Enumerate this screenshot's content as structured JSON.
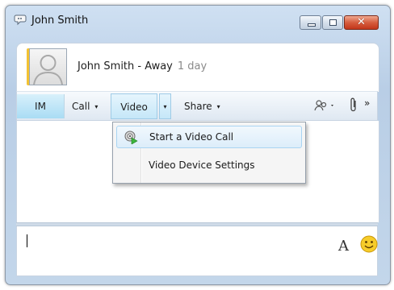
{
  "window": {
    "title": "John Smith",
    "buttons": {
      "minimize": "minimize",
      "maximize": "maximize",
      "close": "✕"
    }
  },
  "contact": {
    "name_status": "John Smith - Away",
    "duration": "1 day"
  },
  "toolbar": {
    "im": "IM",
    "call": "Call",
    "video": "Video",
    "share": "Share",
    "caret": "▾",
    "more": "»"
  },
  "video_menu": {
    "items": [
      {
        "label": "Start a Video Call",
        "highlighted": true,
        "icon": "video-call-icon"
      },
      {
        "label": "Video Device Settings",
        "highlighted": false
      }
    ]
  },
  "compose": {
    "font_label": "A"
  },
  "colors": {
    "presence_away": "#f3c233",
    "im_tab": "#a9dcf4",
    "menu_highlight": "#dcedfa"
  }
}
